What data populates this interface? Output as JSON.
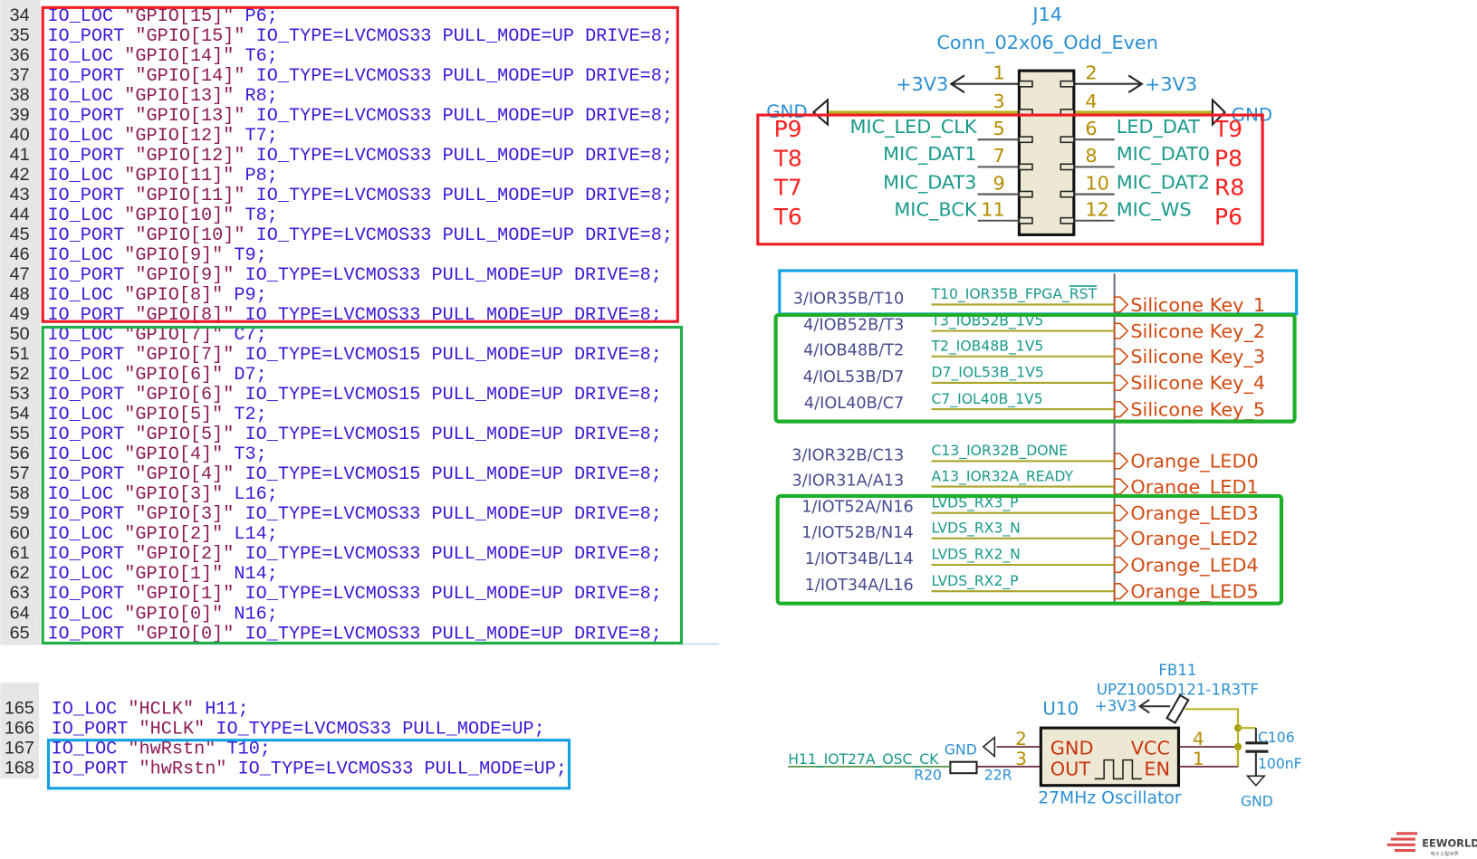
{
  "code_top": {
    "lines": [
      {
        "n": "34",
        "t": "IO_LOC \"GPIO[15]\" P6;"
      },
      {
        "n": "35",
        "t": "IO_PORT \"GPIO[15]\" IO_TYPE=LVCMOS33 PULL_MODE=UP DRIVE=8;"
      },
      {
        "n": "36",
        "t": "IO_LOC \"GPIO[14]\" T6;"
      },
      {
        "n": "37",
        "t": "IO_PORT \"GPIO[14]\" IO_TYPE=LVCMOS33 PULL_MODE=UP DRIVE=8;"
      },
      {
        "n": "38",
        "t": "IO_LOC \"GPIO[13]\" R8;"
      },
      {
        "n": "39",
        "t": "IO_PORT \"GPIO[13]\" IO_TYPE=LVCMOS33 PULL_MODE=UP DRIVE=8;"
      },
      {
        "n": "40",
        "t": "IO_LOC \"GPIO[12]\" T7;"
      },
      {
        "n": "41",
        "t": "IO_PORT \"GPIO[12]\" IO_TYPE=LVCMOS33 PULL_MODE=UP DRIVE=8;"
      },
      {
        "n": "42",
        "t": "IO_LOC \"GPIO[11]\" P8;"
      },
      {
        "n": "43",
        "t": "IO_PORT \"GPIO[11]\" IO_TYPE=LVCMOS33 PULL_MODE=UP DRIVE=8;"
      },
      {
        "n": "44",
        "t": "IO_LOC \"GPIO[10]\" T8;"
      },
      {
        "n": "45",
        "t": "IO_PORT \"GPIO[10]\" IO_TYPE=LVCMOS33 PULL_MODE=UP DRIVE=8;"
      },
      {
        "n": "46",
        "t": "IO_LOC \"GPIO[9]\" T9;"
      },
      {
        "n": "47",
        "t": "IO_PORT \"GPIO[9]\" IO_TYPE=LVCMOS33 PULL_MODE=UP DRIVE=8;"
      },
      {
        "n": "48",
        "t": "IO_LOC \"GPIO[8]\" P9;"
      },
      {
        "n": "49",
        "t": "IO_PORT \"GPIO[8]\" IO_TYPE=LVCMOS33 PULL_MODE=UP DRIVE=8;"
      },
      {
        "n": "50",
        "t": "IO_LOC \"GPIO[7]\" C7;"
      },
      {
        "n": "51",
        "t": "IO_PORT \"GPIO[7]\" IO_TYPE=LVCMOS15 PULL_MODE=UP DRIVE=8;"
      },
      {
        "n": "52",
        "t": "IO_LOC \"GPIO[6]\" D7;"
      },
      {
        "n": "53",
        "t": "IO_PORT \"GPIO[6]\" IO_TYPE=LVCMOS15 PULL_MODE=UP DRIVE=8;"
      },
      {
        "n": "54",
        "t": "IO_LOC \"GPIO[5]\" T2;"
      },
      {
        "n": "55",
        "t": "IO_PORT \"GPIO[5]\" IO_TYPE=LVCMOS15 PULL_MODE=UP DRIVE=8;"
      },
      {
        "n": "56",
        "t": "IO_LOC \"GPIO[4]\" T3;"
      },
      {
        "n": "57",
        "t": "IO_PORT \"GPIO[4]\" IO_TYPE=LVCMOS15 PULL_MODE=UP DRIVE=8;"
      },
      {
        "n": "58",
        "t": "IO_LOC \"GPIO[3]\" L16;"
      },
      {
        "n": "59",
        "t": "IO_PORT \"GPIO[3]\" IO_TYPE=LVCMOS33 PULL_MODE=UP DRIVE=8;"
      },
      {
        "n": "60",
        "t": "IO_LOC \"GPIO[2]\" L14;"
      },
      {
        "n": "61",
        "t": "IO_PORT \"GPIO[2]\" IO_TYPE=LVCMOS33 PULL_MODE=UP DRIVE=8;"
      },
      {
        "n": "62",
        "t": "IO_LOC \"GPIO[1]\" N14;"
      },
      {
        "n": "63",
        "t": "IO_PORT \"GPIO[1]\" IO_TYPE=LVCMOS33 PULL_MODE=UP DRIVE=8;"
      },
      {
        "n": "64",
        "t": "IO_LOC \"GPIO[0]\" N16;"
      },
      {
        "n": "65",
        "t": "IO_PORT \"GPIO[0]\" IO_TYPE=LVCMOS33 PULL_MODE=UP DRIVE=8;"
      }
    ]
  },
  "code_bottom": {
    "lines": [
      {
        "n": "165",
        "t": "IO_LOC \"HCLK\" H11;"
      },
      {
        "n": "166",
        "t": "IO_PORT \"HCLK\" IO_TYPE=LVCMOS33 PULL_MODE=UP;"
      },
      {
        "n": "167",
        "t": "IO_LOC \"hwRstn\" T10;"
      },
      {
        "n": "168",
        "t": "IO_PORT \"hwRstn\" IO_TYPE=LVCMOS33 PULL_MODE=UP;"
      }
    ]
  },
  "code_colors": {
    "keyword": "#3d17d8",
    "string": "#8c1a55",
    "number": "#178a8a"
  },
  "highlight_colors": {
    "red": "#ee1c24",
    "green": "#1fae48",
    "blue": "#12a0e4"
  },
  "connector": {
    "ref": "J14",
    "value": "Conn_02x06_Odd_Even",
    "power_left": "+3V3",
    "power_right": "+3V3",
    "gnd_left": "GND",
    "gnd_right": "GND",
    "pins_left": [
      "1",
      "3",
      "5",
      "7",
      "9",
      "11"
    ],
    "pins_right": [
      "2",
      "4",
      "6",
      "8",
      "10",
      "12"
    ],
    "nets_left": [
      "MIC_LED_CLK",
      "MIC_DAT1",
      "MIC_DAT3",
      "MIC_BCK"
    ],
    "nets_right": [
      "LED_DAT",
      "MIC_DAT0",
      "MIC_DAT2",
      "MIC_WS"
    ],
    "fpga_pins_left": [
      "P9",
      "T8",
      "T7",
      "T6"
    ],
    "fpga_pins_right": [
      "T9",
      "P8",
      "R8",
      "P6"
    ]
  },
  "fpga_io": {
    "rows": [
      {
        "pin": "3/IOR35B/T10",
        "net": "T10_IOR35B_FPGA_",
        "net_overline": "RST",
        "label": "Silicone Key_1"
      },
      {
        "pin": "4/IOB52B/T3",
        "net": "T3_IOB52B_1V5",
        "label": "Silicone Key_2"
      },
      {
        "pin": "4/IOB48B/T2",
        "net": "T2_IOB48B_1V5",
        "label": "Silicone Key_3"
      },
      {
        "pin": "4/IOL53B/D7",
        "net": "D7_IOL53B_1V5",
        "label": "Silicone Key_4"
      },
      {
        "pin": "4/IOL40B/C7",
        "net": "C7_IOL40B_1V5",
        "label": "Silicone Key_5"
      },
      {
        "pin": "3/IOR32B/C13",
        "net": "C13_IOR32B_DONE",
        "label": "Orange_LED0"
      },
      {
        "pin": "3/IOR31A/A13",
        "net": "A13_IOR32A_READY",
        "label": "Orange_LED1"
      },
      {
        "pin": "1/IOT52A/N16",
        "net": "LVDS_RX3_P",
        "label": "Orange_LED3"
      },
      {
        "pin": "1/IOT52B/N14",
        "net": "LVDS_RX3_N",
        "label": "Orange_LED2"
      },
      {
        "pin": "1/IOT34B/L14",
        "net": "LVDS_RX2_N",
        "label": "Orange_LED4"
      },
      {
        "pin": "1/IOT34A/L16",
        "net": "LVDS_RX2_P",
        "label": "Orange_LED5"
      }
    ]
  },
  "oscillator": {
    "ref": "U10",
    "value": "27MHz Oscillator",
    "pin_gnd": "GND",
    "pin_vcc": "VCC",
    "pin_out": "OUT",
    "pin_en": "EN",
    "pin2": "2",
    "pin3": "3",
    "pin4": "4",
    "pin1": "1",
    "gnd_label": "GND",
    "net": "H11_IOT27A_OSC_CK",
    "resistor_ref": "R20",
    "resistor_value": "22R",
    "ferrite_ref": "FB11",
    "ferrite_value": "UPZ1005D121-1R3TF",
    "power": "+3V3",
    "cap_ref": "C106",
    "cap_value": "100nF",
    "cap_gnd": "GND"
  },
  "watermark": {
    "brand": "EEWORLD",
    "sub": "电子工程世界"
  }
}
